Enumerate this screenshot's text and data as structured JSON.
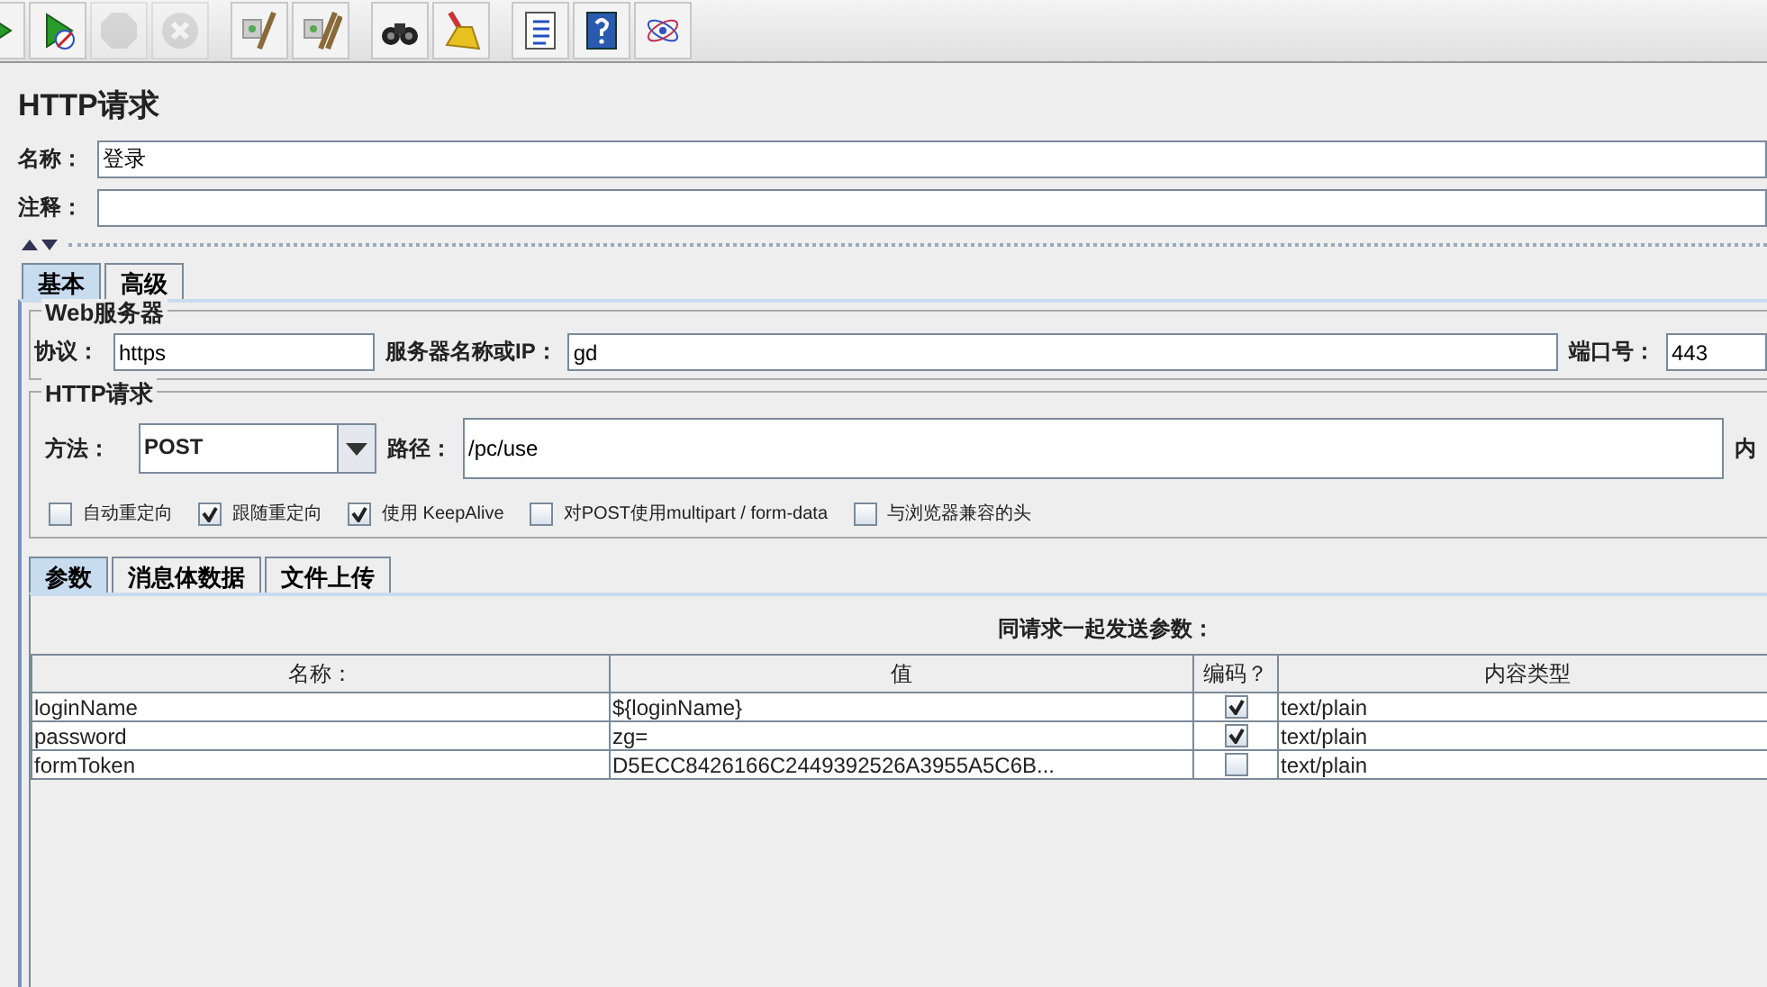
{
  "toolbar": [
    {
      "kind": "start",
      "disabled": false
    },
    {
      "kind": "start-no-pause",
      "disabled": false
    },
    {
      "kind": "stop",
      "disabled": true
    },
    {
      "kind": "shutdown",
      "disabled": true
    },
    {
      "kind": "clear",
      "disabled": false
    },
    {
      "kind": "clear-all",
      "disabled": false
    },
    {
      "kind": "search",
      "disabled": false
    },
    {
      "kind": "reset-search",
      "disabled": false
    },
    {
      "kind": "function-list",
      "disabled": false
    },
    {
      "kind": "help",
      "disabled": false
    },
    {
      "kind": "function-helper",
      "disabled": false
    }
  ],
  "title": "HTTP请求",
  "name_field": {
    "label": "名称：",
    "value": "登录"
  },
  "comment_field": {
    "label": "注释："
  },
  "tabs": [
    {
      "label": "基本",
      "selected": true
    },
    {
      "label": "高级",
      "selected": false
    }
  ],
  "web_server": {
    "legend": "Web服务器",
    "protocol_label": "协议：",
    "protocol": "https",
    "server_label": "服务器名称或IP：",
    "server": "gd",
    "port_label": "端口号：",
    "port": "443"
  },
  "http_request": {
    "legend": "HTTP请求",
    "method_label": "方法：",
    "method": "POST",
    "path_label": "路径：",
    "path": "/pc/use",
    "content_label": "内"
  },
  "options": [
    {
      "label": "自动重定向",
      "checked": false
    },
    {
      "label": "跟随重定向",
      "checked": true
    },
    {
      "label": "使用 KeepAlive",
      "checked": true
    },
    {
      "label": "对POST使用multipart / form-data",
      "checked": false
    },
    {
      "label": "与浏览器兼容的头",
      "checked": false
    }
  ],
  "sub_tabs": [
    {
      "label": "参数",
      "selected": true
    },
    {
      "label": "消息体数据",
      "selected": false
    },
    {
      "label": "文件上传",
      "selected": false
    }
  ],
  "params": {
    "caption": "同请求一起发送参数：",
    "columns": [
      "名称：",
      "值",
      "编码？",
      "内容类型"
    ],
    "rows": [
      {
        "name": "loginName",
        "value": "${loginName}",
        "encode": true,
        "type": "text/plain"
      },
      {
        "name": "password",
        "value": "zg=",
        "encode": true,
        "type": "text/plain"
      },
      {
        "name": "formToken",
        "value": "D5ECC8426166C2449392526A3955A5C6B...",
        "encode": false,
        "type": "text/plain"
      }
    ]
  }
}
